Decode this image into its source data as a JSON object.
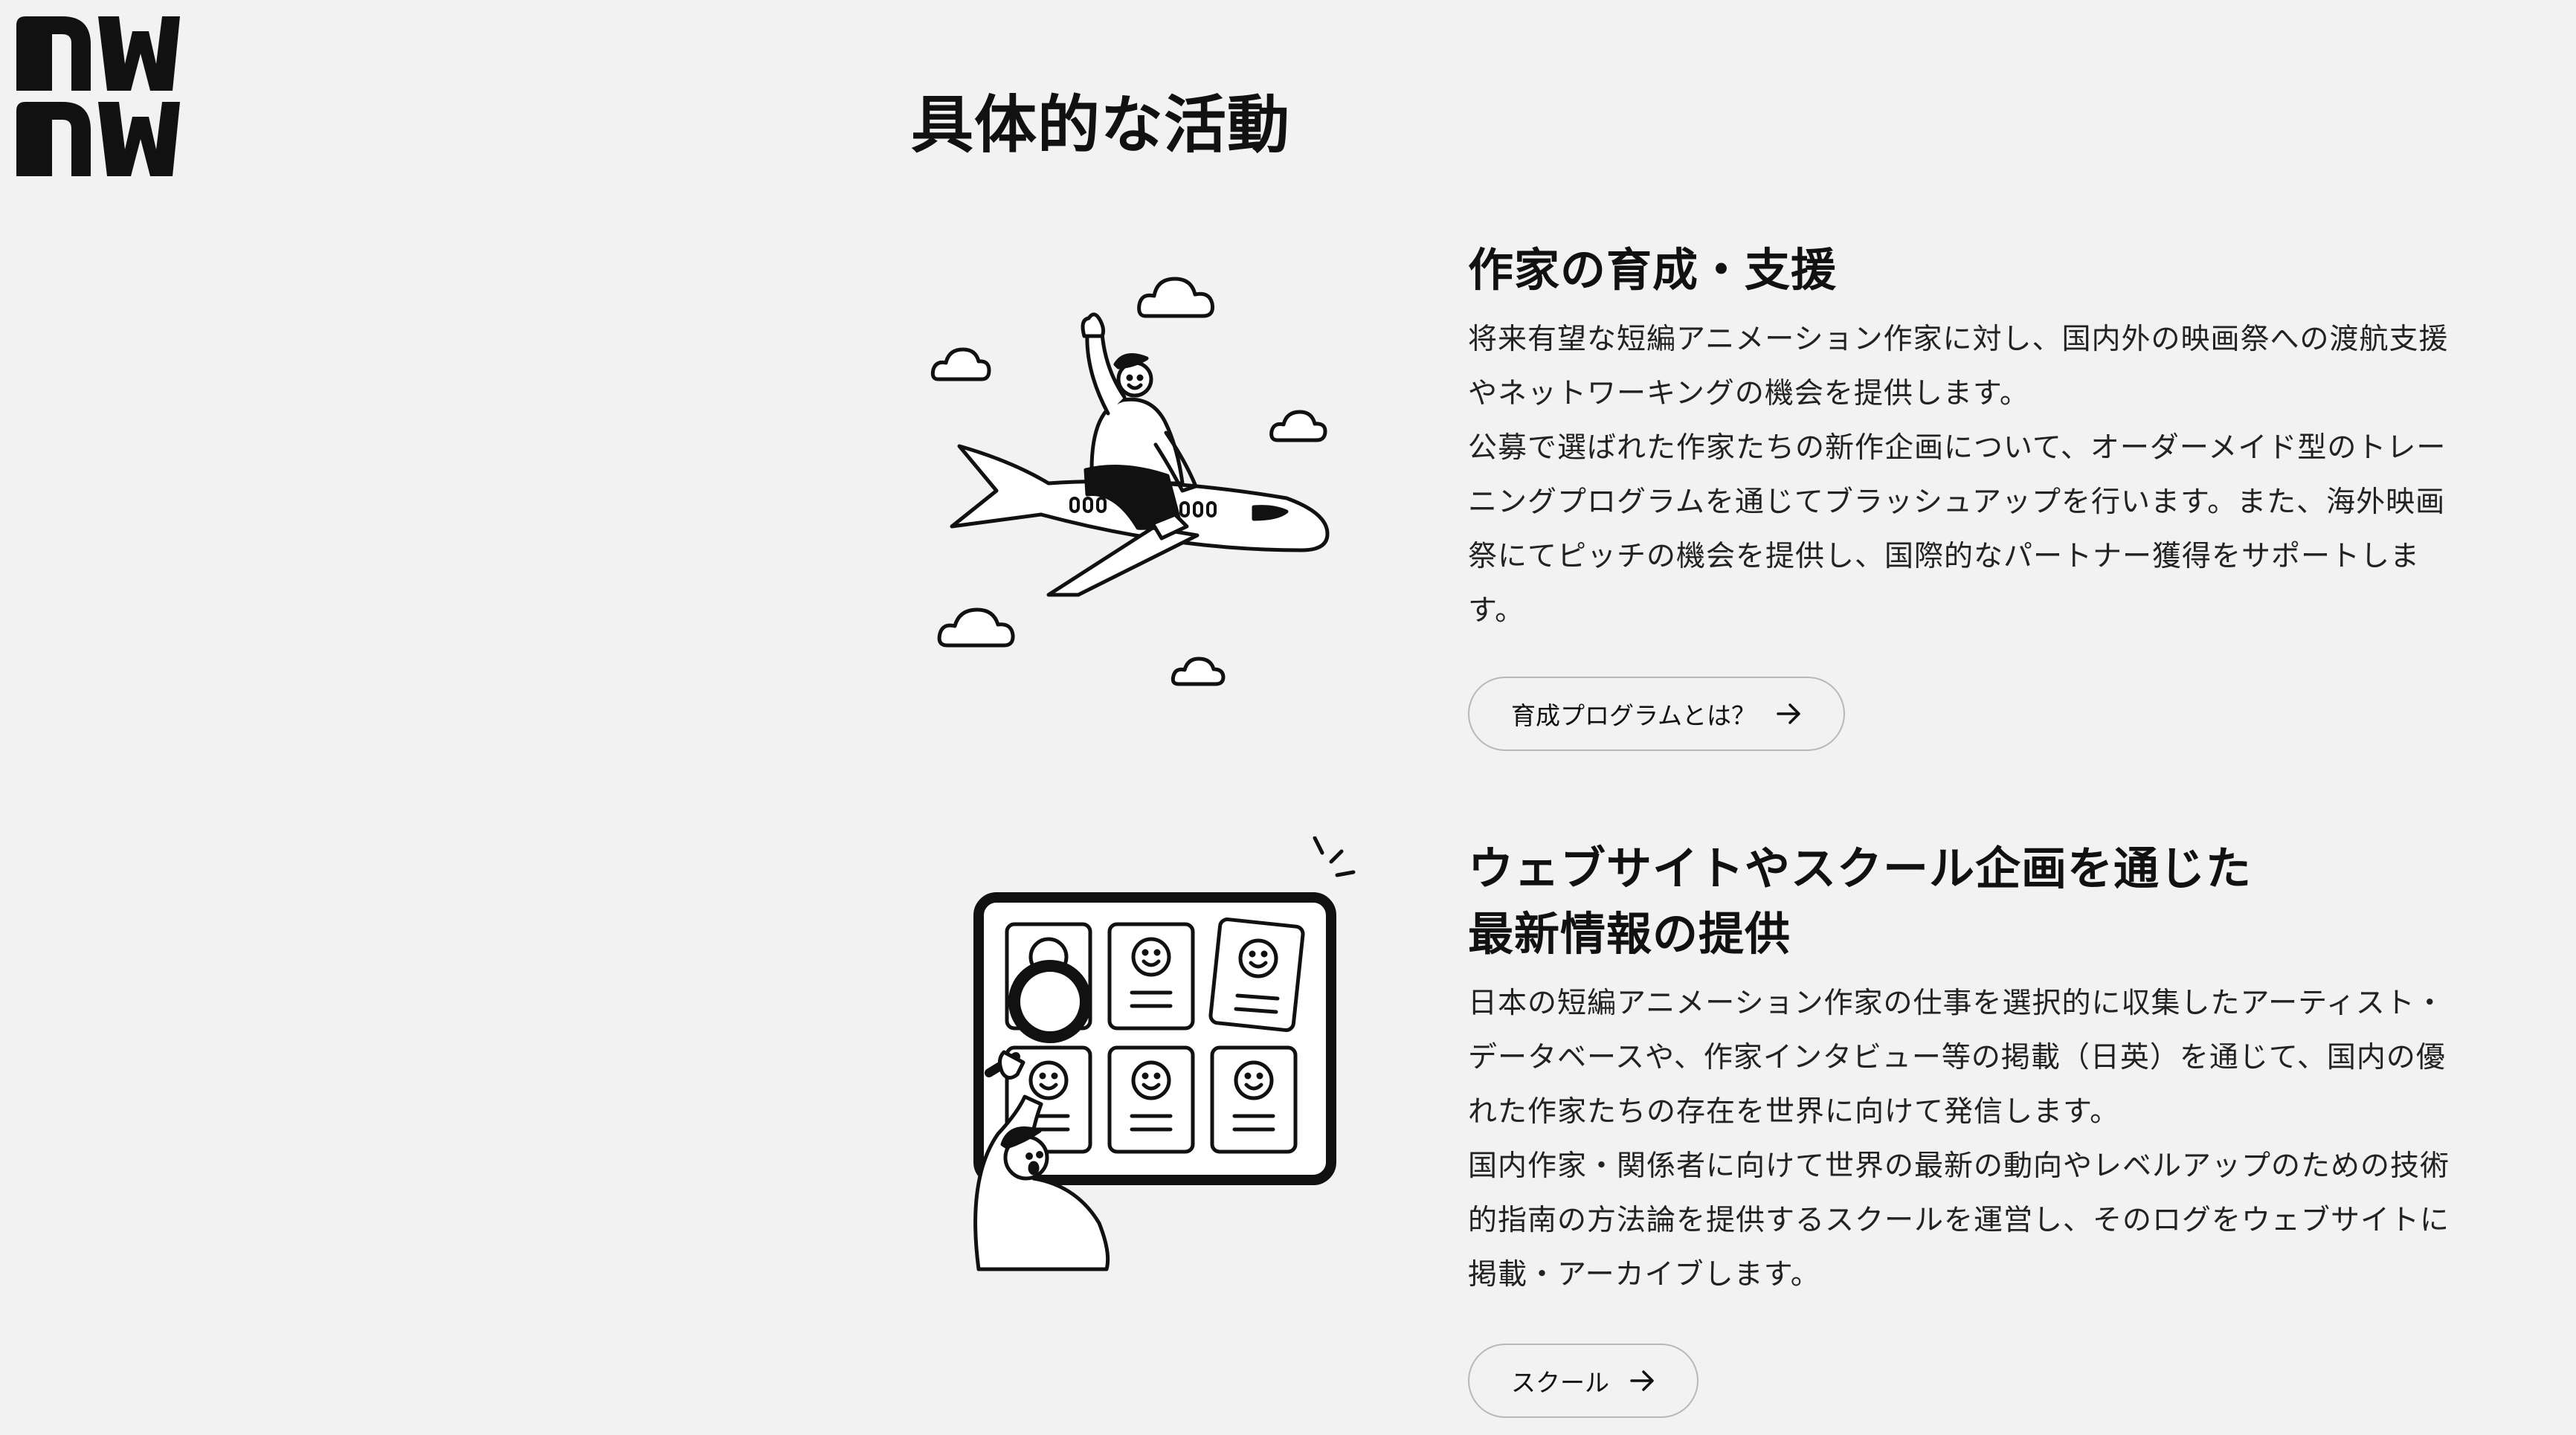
{
  "logo": {
    "icon": "nwnw-logo-icon",
    "alt": "nwnw"
  },
  "section": {
    "title": "具体的な活動"
  },
  "activities": [
    {
      "illustration": "person-riding-airplane-illustration",
      "title": "作家の育成・支援",
      "paragraphs": [
        "将来有望な短編アニメーション作家に対し、国内外の映画祭への渡航支援やネットワーキングの機会を提供します。",
        "公募で選ばれた作家たちの新作企画について、オーダーメイド型のトレーニングプログラムを通じてブラッシュアップを行います。また、海外映画祭にてピッチの機会を提供し、国際的なパートナー獲得をサポートします。"
      ],
      "button": {
        "label": "育成プログラムとは？",
        "icon": "arrow-right-icon"
      }
    },
    {
      "illustration": "person-with-magnifier-database-illustration",
      "title_lines": [
        "ウェブサイトやスクール企画を通じた",
        "最新情報の提供"
      ],
      "paragraphs": [
        "日本の短編アニメーション作家の仕事を選択的に収集したアーティスト・データベースや、作家インタビュー等の掲載（日英）を通じて、国内の優れた作家たちの存在を世界に向けて発信します。",
        "国内作家・関係者に向けて世界の最新の動向やレベルアップのための技術的指南の方法論を提供するスクールを運営し、そのログをウェブサイトに掲載・アーカイブします。"
      ],
      "button": {
        "label": "スクール",
        "icon": "arrow-right-icon"
      }
    }
  ],
  "colors": {
    "background": "#f2f2f2",
    "text": "#111111",
    "button_border": "#b8b8b8"
  }
}
